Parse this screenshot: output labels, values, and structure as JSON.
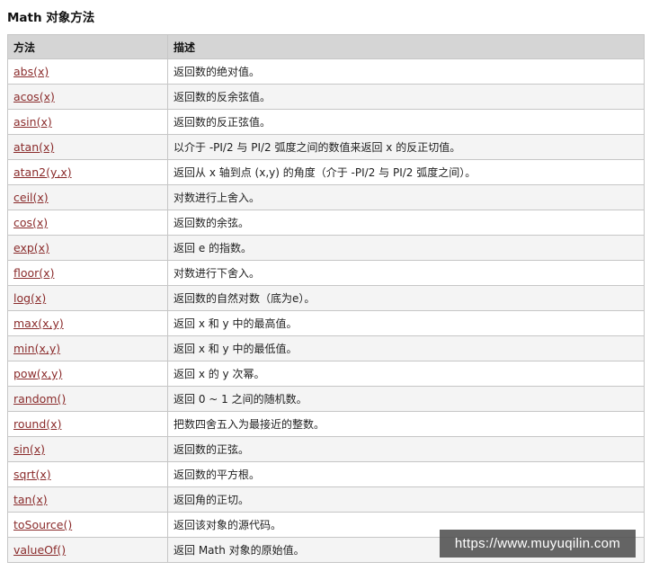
{
  "title": "Math 对象方法",
  "table": {
    "headers": [
      "方法",
      "描述"
    ],
    "rows": [
      {
        "method": "abs(x)",
        "desc": "返回数的绝对值。"
      },
      {
        "method": "acos(x)",
        "desc": "返回数的反余弦值。"
      },
      {
        "method": "asin(x)",
        "desc": "返回数的反正弦值。"
      },
      {
        "method": "atan(x)",
        "desc": "以介于 -PI/2 与 PI/2 弧度之间的数值来返回 x 的反正切值。"
      },
      {
        "method": "atan2(y,x)",
        "desc": "返回从 x 轴到点 (x,y) 的角度（介于 -PI/2 与 PI/2 弧度之间）。"
      },
      {
        "method": "ceil(x)",
        "desc": "对数进行上舍入。"
      },
      {
        "method": "cos(x)",
        "desc": "返回数的余弦。"
      },
      {
        "method": "exp(x)",
        "desc": "返回 e 的指数。"
      },
      {
        "method": "floor(x)",
        "desc": "对数进行下舍入。"
      },
      {
        "method": "log(x)",
        "desc": "返回数的自然对数（底为e）。"
      },
      {
        "method": "max(x,y)",
        "desc": "返回 x 和 y 中的最高值。"
      },
      {
        "method": "min(x,y)",
        "desc": "返回 x 和 y 中的最低值。"
      },
      {
        "method": "pow(x,y)",
        "desc": "返回 x 的 y 次幂。"
      },
      {
        "method": "random()",
        "desc": "返回 0 ~ 1 之间的随机数。"
      },
      {
        "method": "round(x)",
        "desc": "把数四舍五入为最接近的整数。"
      },
      {
        "method": "sin(x)",
        "desc": "返回数的正弦。"
      },
      {
        "method": "sqrt(x)",
        "desc": "返回数的平方根。"
      },
      {
        "method": "tan(x)",
        "desc": "返回角的正切。"
      },
      {
        "method": "toSource()",
        "desc": "返回该对象的源代码。"
      },
      {
        "method": "valueOf()",
        "desc": "返回 Math 对象的原始值。"
      }
    ]
  },
  "watermark": "https://www.muyuqilin.com"
}
